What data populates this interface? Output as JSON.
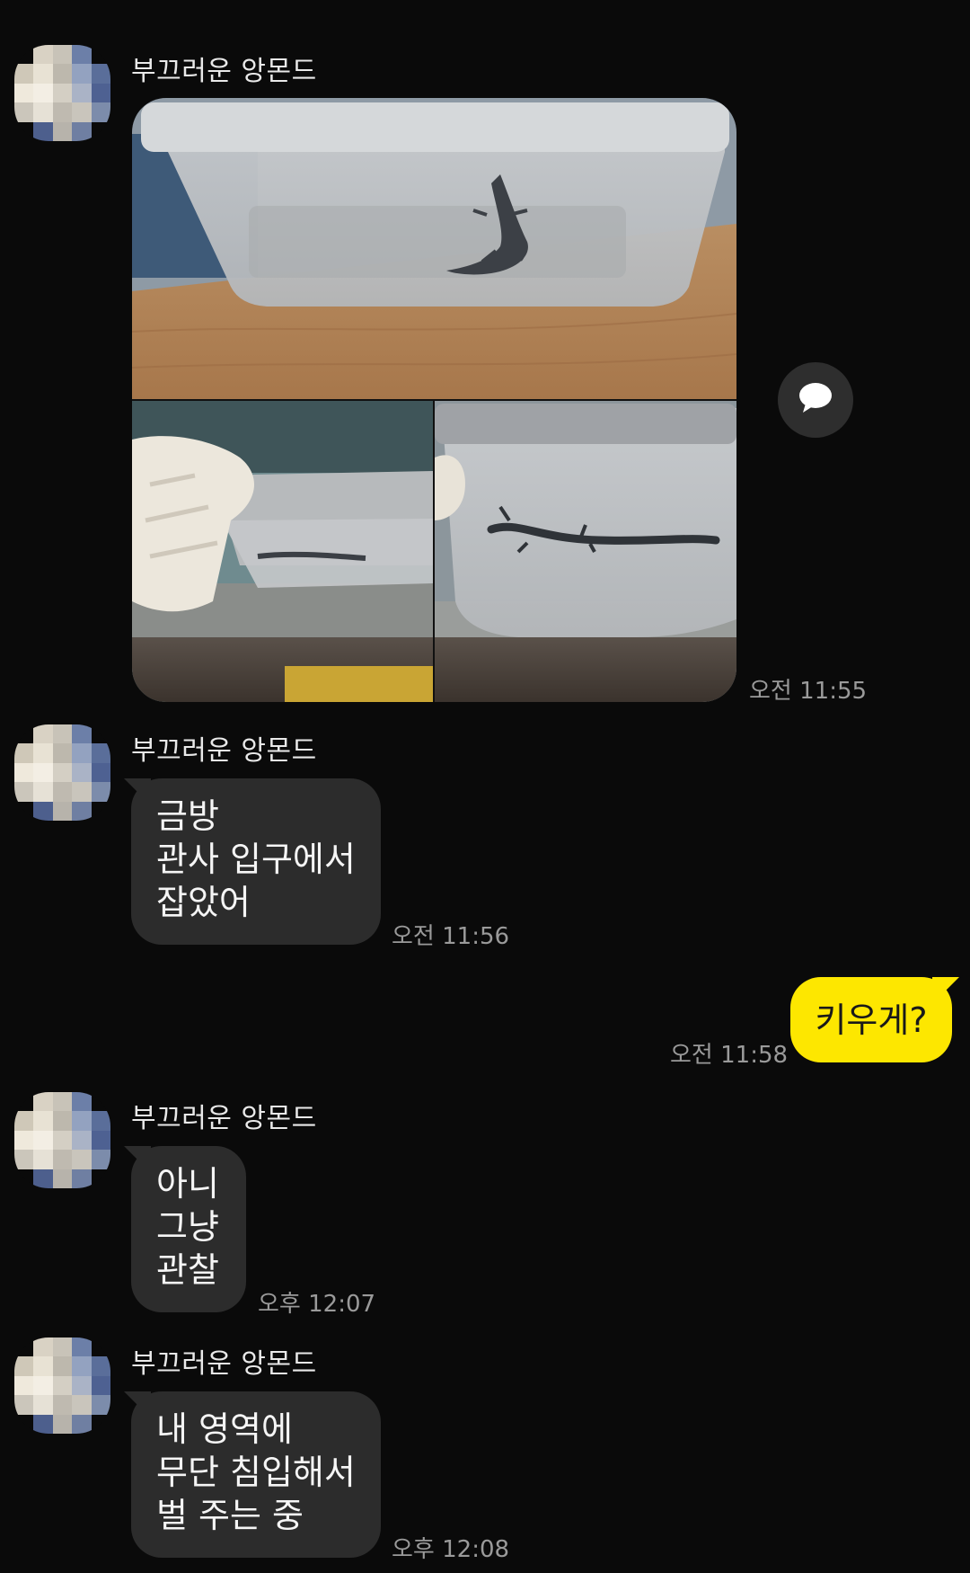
{
  "messages": [
    {
      "sender": "부끄러운 앙몬드",
      "type": "photos",
      "time": "오전 11:55"
    },
    {
      "sender": "부끄러운 앙몬드",
      "text": "금방\n관사 입구에서\n잡았어",
      "time": "오전 11:56"
    },
    {
      "sender": "me",
      "text": "키우게?",
      "time": "오전 11:58"
    },
    {
      "sender": "부끄러운 앙몬드",
      "text": "아니\n그냥\n관찰",
      "time": "오후 12:07"
    },
    {
      "sender": "부끄러운 앙몬드",
      "text": "내 영역에\n무단 침입해서\n벌 주는 중",
      "time": "오후 12:08"
    }
  ],
  "icons": {
    "share": "speech-bubble-icon"
  },
  "colors": {
    "background": "#0a0a0a",
    "incoming_bubble": "#2c2c2c",
    "outgoing_bubble": "#fde700",
    "time_text": "#9a9a9a"
  }
}
